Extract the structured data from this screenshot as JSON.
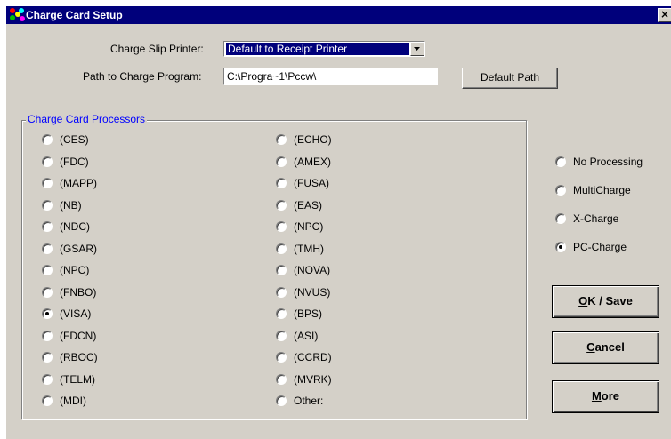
{
  "window": {
    "title": "Charge Card Setup",
    "close": "×"
  },
  "printer": {
    "label": "Charge Slip Printer:",
    "value": "Default to Receipt Printer"
  },
  "path": {
    "label": "Path to Charge Program:",
    "value": "C:\\Progra~1\\Pccw\\",
    "default_button": "Default Path"
  },
  "processors": {
    "title": "Charge Card Processors",
    "col1": [
      {
        "label": "(CES)",
        "selected": false
      },
      {
        "label": "(FDC)",
        "selected": false
      },
      {
        "label": "(MAPP)",
        "selected": false
      },
      {
        "label": "(NB)",
        "selected": false
      },
      {
        "label": "(NDC)",
        "selected": false
      },
      {
        "label": "(GSAR)",
        "selected": false
      },
      {
        "label": "(NPC)",
        "selected": false
      },
      {
        "label": "(FNBO)",
        "selected": false
      },
      {
        "label": "(VISA)",
        "selected": true
      },
      {
        "label": "(FDCN)",
        "selected": false
      },
      {
        "label": "(RBOC)",
        "selected": false
      },
      {
        "label": "(TELM)",
        "selected": false
      },
      {
        "label": "(MDI)",
        "selected": false
      }
    ],
    "col2": [
      {
        "label": "(ECHO)",
        "selected": false
      },
      {
        "label": "(AMEX)",
        "selected": false
      },
      {
        "label": "(FUSA)",
        "selected": false
      },
      {
        "label": "(EAS)",
        "selected": false
      },
      {
        "label": "(NPC)",
        "selected": false
      },
      {
        "label": "(TMH)",
        "selected": false
      },
      {
        "label": "(NOVA)",
        "selected": false
      },
      {
        "label": "(NVUS)",
        "selected": false
      },
      {
        "label": "(BPS)",
        "selected": false
      },
      {
        "label": "(ASI)",
        "selected": false
      },
      {
        "label": "(CCRD)",
        "selected": false
      },
      {
        "label": "(MVRK)",
        "selected": false
      },
      {
        "label": "Other:",
        "selected": false
      }
    ]
  },
  "processing": [
    {
      "label": "No Processing",
      "selected": false
    },
    {
      "label": "MultiCharge",
      "selected": false
    },
    {
      "label": "X-Charge",
      "selected": false
    },
    {
      "label": "PC-Charge",
      "selected": true
    }
  ],
  "buttons": {
    "ok_save": {
      "accel": "O",
      "rest": "K / Save"
    },
    "cancel": {
      "accel": "C",
      "rest": "ancel"
    },
    "more": {
      "accel": "M",
      "rest": "ore"
    }
  },
  "colors": {
    "titlebar": "#00007b",
    "face": "#d4d0c8",
    "group_title": "#0000ff",
    "selection": "#00007b"
  },
  "icons": [
    "app-icon",
    "close-icon",
    "dropdown-arrow-icon"
  ]
}
